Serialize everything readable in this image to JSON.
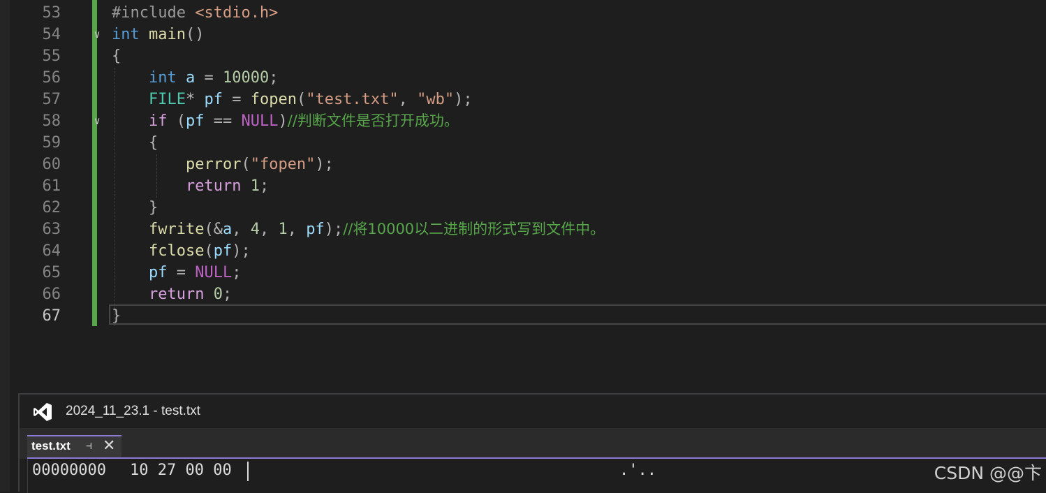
{
  "editor": {
    "lines": [
      {
        "num": "53",
        "fold": "",
        "segments": [
          [
            "pre",
            "#include "
          ],
          [
            "inc",
            "<stdio.h>"
          ]
        ]
      },
      {
        "num": "54",
        "fold": "∨",
        "segments": [
          [
            "kw",
            "int"
          ],
          [
            "punc",
            " "
          ],
          [
            "fn",
            "main"
          ],
          [
            "punc",
            "()"
          ]
        ]
      },
      {
        "num": "55",
        "fold": "",
        "segments": [
          [
            "punc",
            "{"
          ]
        ]
      },
      {
        "num": "56",
        "fold": "",
        "segments": [
          [
            "punc",
            "    "
          ],
          [
            "kw",
            "int"
          ],
          [
            "punc",
            " "
          ],
          [
            "var",
            "a"
          ],
          [
            "punc",
            " = "
          ],
          [
            "num",
            "10000"
          ],
          [
            "punc",
            ";"
          ]
        ]
      },
      {
        "num": "57",
        "fold": "",
        "segments": [
          [
            "punc",
            "    "
          ],
          [
            "type",
            "FILE"
          ],
          [
            "punc",
            "* "
          ],
          [
            "var",
            "pf"
          ],
          [
            "punc",
            " = "
          ],
          [
            "fn",
            "fopen"
          ],
          [
            "punc",
            "("
          ],
          [
            "str",
            "\"test.txt\""
          ],
          [
            "punc",
            ", "
          ],
          [
            "str",
            "\"wb\""
          ],
          [
            "punc",
            ");"
          ]
        ]
      },
      {
        "num": "58",
        "fold": "∨",
        "segments": [
          [
            "punc",
            "    "
          ],
          [
            "ctl",
            "if"
          ],
          [
            "punc",
            " ("
          ],
          [
            "var",
            "pf"
          ],
          [
            "punc",
            " == "
          ],
          [
            "mac",
            "NULL"
          ],
          [
            "punc",
            ")"
          ],
          [
            "cmt",
            "//判断文件是否打开成功。"
          ]
        ]
      },
      {
        "num": "59",
        "fold": "",
        "segments": [
          [
            "punc",
            "    {"
          ]
        ]
      },
      {
        "num": "60",
        "fold": "",
        "segments": [
          [
            "punc",
            "        "
          ],
          [
            "fn",
            "perror"
          ],
          [
            "punc",
            "("
          ],
          [
            "str",
            "\"fopen\""
          ],
          [
            "punc",
            ");"
          ]
        ]
      },
      {
        "num": "61",
        "fold": "",
        "segments": [
          [
            "punc",
            "        "
          ],
          [
            "ctl",
            "return"
          ],
          [
            "punc",
            " "
          ],
          [
            "num",
            "1"
          ],
          [
            "punc",
            ";"
          ]
        ]
      },
      {
        "num": "62",
        "fold": "",
        "segments": [
          [
            "punc",
            "    }"
          ]
        ]
      },
      {
        "num": "63",
        "fold": "",
        "segments": [
          [
            "punc",
            "    "
          ],
          [
            "fn",
            "fwrite"
          ],
          [
            "punc",
            "(&"
          ],
          [
            "var",
            "a"
          ],
          [
            "punc",
            ", "
          ],
          [
            "num",
            "4"
          ],
          [
            "punc",
            ", "
          ],
          [
            "num",
            "1"
          ],
          [
            "punc",
            ", "
          ],
          [
            "var",
            "pf"
          ],
          [
            "punc",
            ");"
          ],
          [
            "cmt",
            "//将10000以二进制的形式写到文件中。"
          ]
        ]
      },
      {
        "num": "64",
        "fold": "",
        "segments": [
          [
            "punc",
            "    "
          ],
          [
            "fn",
            "fclose"
          ],
          [
            "punc",
            "("
          ],
          [
            "var",
            "pf"
          ],
          [
            "punc",
            ");"
          ]
        ]
      },
      {
        "num": "65",
        "fold": "",
        "segments": [
          [
            "punc",
            "    "
          ],
          [
            "var",
            "pf"
          ],
          [
            "punc",
            " = "
          ],
          [
            "mac",
            "NULL"
          ],
          [
            "punc",
            ";"
          ]
        ]
      },
      {
        "num": "66",
        "fold": "",
        "segments": [
          [
            "punc",
            "    "
          ],
          [
            "ctl",
            "return"
          ],
          [
            "punc",
            " "
          ],
          [
            "num",
            "0"
          ],
          [
            "punc",
            ";"
          ]
        ]
      },
      {
        "num": "67",
        "fold": "",
        "segments": [
          [
            "punc",
            "}"
          ]
        ],
        "current": true
      }
    ]
  },
  "panel": {
    "title": "2024_11_23.1 - test.txt",
    "tab_label": "test.txt",
    "pin_icon": "pin-icon",
    "close_icon": "close-icon"
  },
  "hex": {
    "offset": "00000000",
    "bytes": "10 27 00 00",
    "ascii": ".'.."
  },
  "watermark": "CSDN @@卞",
  "colors": {
    "background": "#1e1e1e",
    "change_bar": "#57a64a",
    "tab_accent": "#8c7ad6"
  }
}
